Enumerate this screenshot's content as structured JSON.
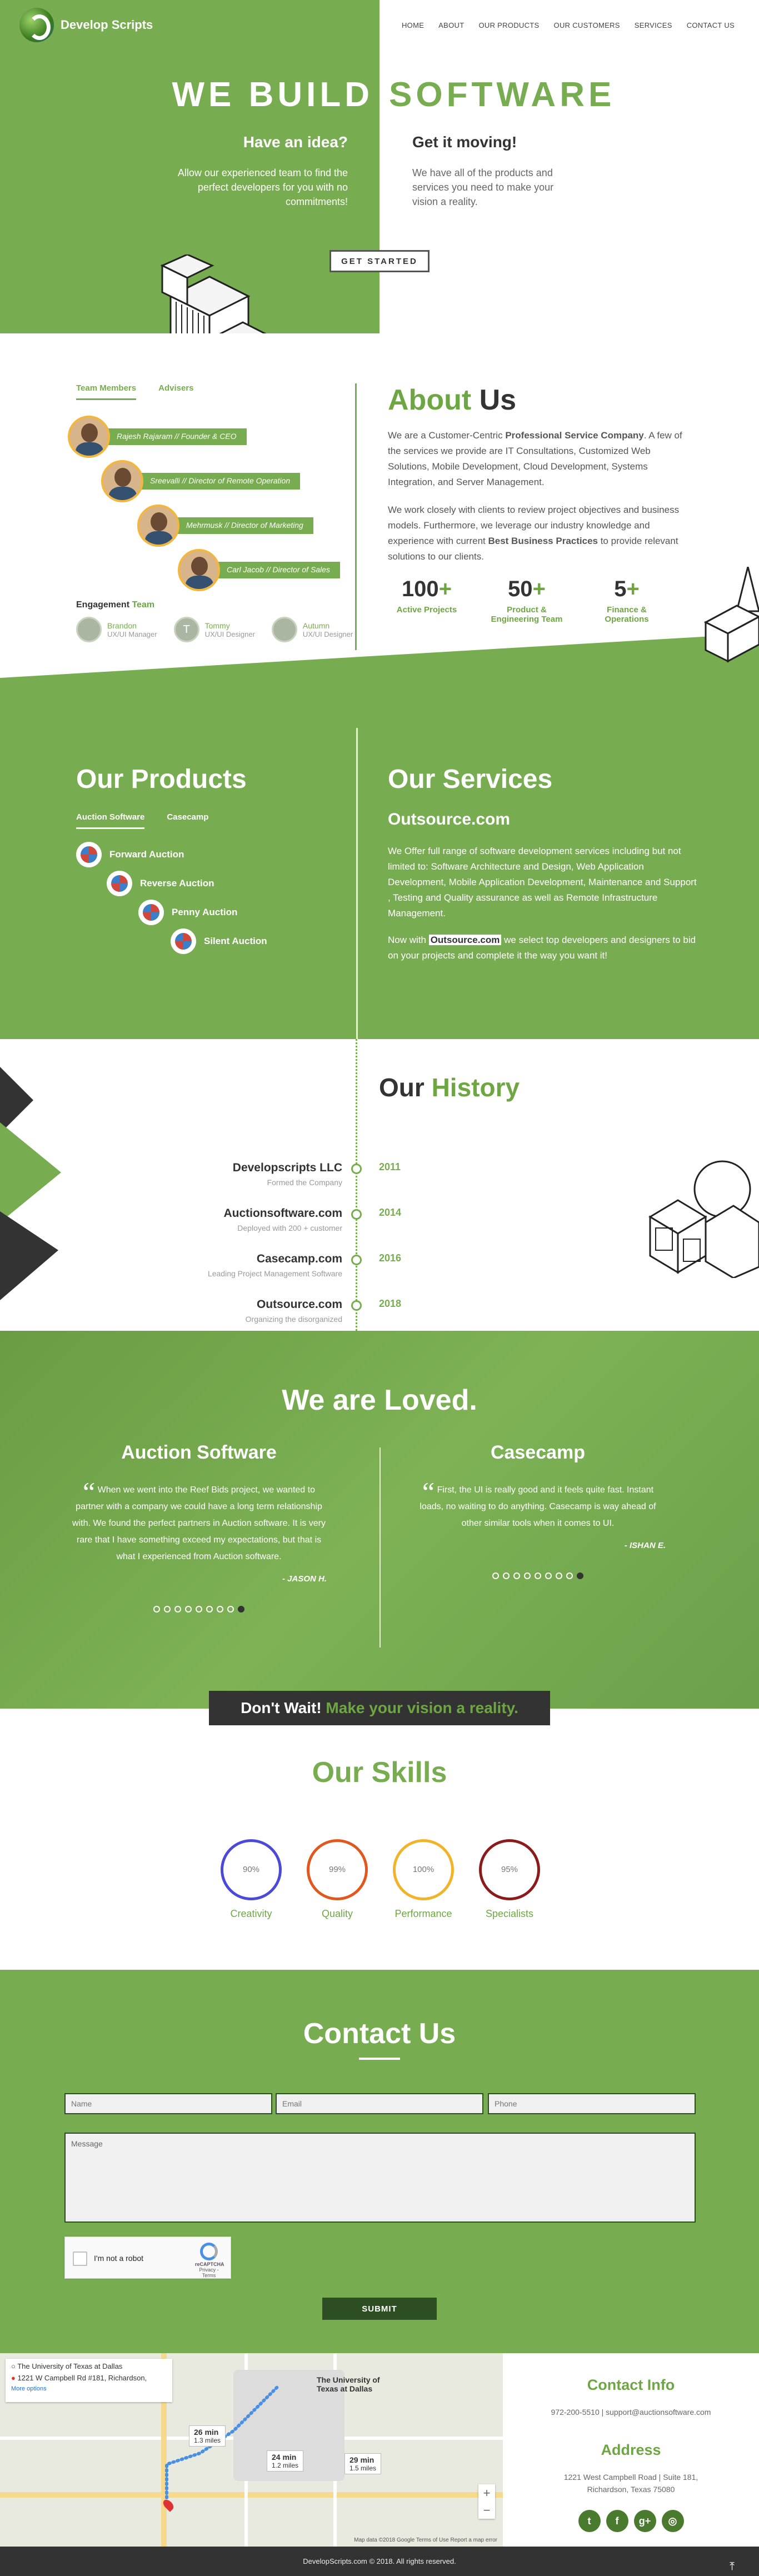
{
  "brand": "Develop Scripts",
  "nav": [
    "HOME",
    "ABOUT",
    "OUR PRODUCTS",
    "OUR CUSTOMERS",
    "SERVICES",
    "CONTACT US"
  ],
  "hero": {
    "title_left": "WE BUILD",
    "title_right": "SOFTWARE",
    "left_heading": "Have an idea?",
    "left_text": "Allow our experienced team to find the perfect developers for you with no commitments!",
    "right_heading": "Get it moving!",
    "right_text": "We have all of the products and services you need to make your vision a reality.",
    "cta": "GET STARTED"
  },
  "about": {
    "tabs": [
      "Team Members",
      "Advisers"
    ],
    "team": [
      "Rajesh Rajaram // Founder & CEO",
      "Sreevalli // Director of Remote Operation",
      "Mehrmusk // Director of Marketing",
      "Carl Jacob // Director of Sales"
    ],
    "engagement_heading": "Engagement",
    "engagement_heading_accent": "Team",
    "engagement": [
      {
        "name": "Brandon",
        "role": "UX/UI Manager",
        "initial": ""
      },
      {
        "name": "Tommy",
        "role": "UX/UI Designer",
        "initial": "T"
      },
      {
        "name": "Autumn",
        "role": "UX/UI Designer",
        "initial": ""
      }
    ],
    "title_accent": "About",
    "title_rest": "Us",
    "p1_pre": "We are a Customer-Centric ",
    "p1_bold": "Professional Service Company",
    "p1_post": ". A few of the services we provide are IT Consultations, Customized Web Solutions, Mobile Development, Cloud Development, Systems Integration, and Server Management.",
    "p2_pre": "We work closely with clients to review project objectives and business models. Furthermore, we leverage our industry knowledge and experience with current ",
    "p2_bold": "Best Business Practices",
    "p2_post": " to provide relevant solutions to our clients.",
    "stats": [
      {
        "n": "100",
        "plus": "+",
        "label": "Active Projects"
      },
      {
        "n": "50",
        "plus": "+",
        "label": "Product & Engineering Team"
      },
      {
        "n": "5",
        "plus": "+",
        "label": "Finance & Operations"
      }
    ]
  },
  "products": {
    "title": "Our Products",
    "tabs": [
      "Auction Software",
      "Casecamp"
    ],
    "items": [
      "Forward Auction",
      "Reverse Auction",
      "Penny Auction",
      "Silent Auction"
    ]
  },
  "services": {
    "title": "Our Services",
    "subtitle": "Outsource.com",
    "p1": "We Offer full range of software development services including but not limited to: Software Architecture and Design, Web Application Development, Mobile Application Development, Maintenance and Support , Testing and Quality assurance as well as Remote Infrastructure Management.",
    "p2_pre": "Now with ",
    "p2_hl": "Outsource.com",
    "p2_post": " we select top developers and designers to bid on your projects and complete it the way you want it!"
  },
  "history": {
    "title": "Our",
    "title_accent": "History",
    "events": [
      {
        "name": "Developscripts LLC",
        "sub": "Formed the Company",
        "year": "2011"
      },
      {
        "name": "Auctionsoftware.com",
        "sub": "Deployed with 200 + customer",
        "year": "2014"
      },
      {
        "name": "Casecamp.com",
        "sub": "Leading Project Management Software",
        "year": "2016"
      },
      {
        "name": "Outsource.com",
        "sub": "Organizing the disorganized",
        "year": "2018"
      }
    ]
  },
  "loved": {
    "title": "We are Loved.",
    "left": {
      "heading": "Auction Software",
      "quote": "When we went into the Reef Bids project, we wanted to partner with a company we could have a long term relationship with. We found the perfect partners in Auction software. It is very rare that I have something exceed my expectations, but that is what I experienced from Auction software.",
      "author": "- JASON H."
    },
    "right": {
      "heading": "Casecamp",
      "quote": "First, the UI is really good and it feels quite fast. Instant loads, no waiting to do anything. Casecamp is way ahead of other similar tools when it comes to UI.",
      "author": "- ISHAN E."
    },
    "banner": "Don't Wait!",
    "banner_accent": "Make your vision a reality."
  },
  "skills": {
    "title": "Our Skills",
    "items": [
      {
        "pct": "90%",
        "label": "Creativity",
        "color": "#4a4ad6"
      },
      {
        "pct": "99%",
        "label": "Quality",
        "color": "#e0581e"
      },
      {
        "pct": "100%",
        "label": "Performance",
        "color": "#f0b32a"
      },
      {
        "pct": "95%",
        "label": "Specialists",
        "color": "#8b1a1a"
      }
    ]
  },
  "contact": {
    "title": "Contact Us",
    "name_ph": "Name",
    "email_ph": "Email",
    "phone_ph": "Phone",
    "message_ph": "Message",
    "captcha": "I'm not a robot",
    "captcha_brand": "reCAPTCHA",
    "captcha_links": "Privacy - Terms",
    "submit": "SUBMIT"
  },
  "map": {
    "from": "The University of Texas at Dallas",
    "to": "1221 W Campbell Rd #181, Richardson,",
    "more": "More options",
    "d1_time": "26 min",
    "d1_dist": "1.3 miles",
    "d2_time": "24 min",
    "d2_dist": "1.2 miles",
    "d3_time": "29 min",
    "d3_dist": "1.5 miles",
    "dest_label": "The University of Texas at Dallas",
    "footer": "Map data ©2018 Google   Terms of Use   Report a map error"
  },
  "info": {
    "contact_title": "Contact Info",
    "contact_line": "972-200-5510 | support@auctionsoftware.com",
    "address_title": "Address",
    "address": "1221 West Campbell Road | Suite 181, Richardson, Texas 75080",
    "socials": [
      "t",
      "f",
      "g+",
      "◎"
    ]
  },
  "footer": "DevelopScripts.com © 2018. All rights reserved."
}
